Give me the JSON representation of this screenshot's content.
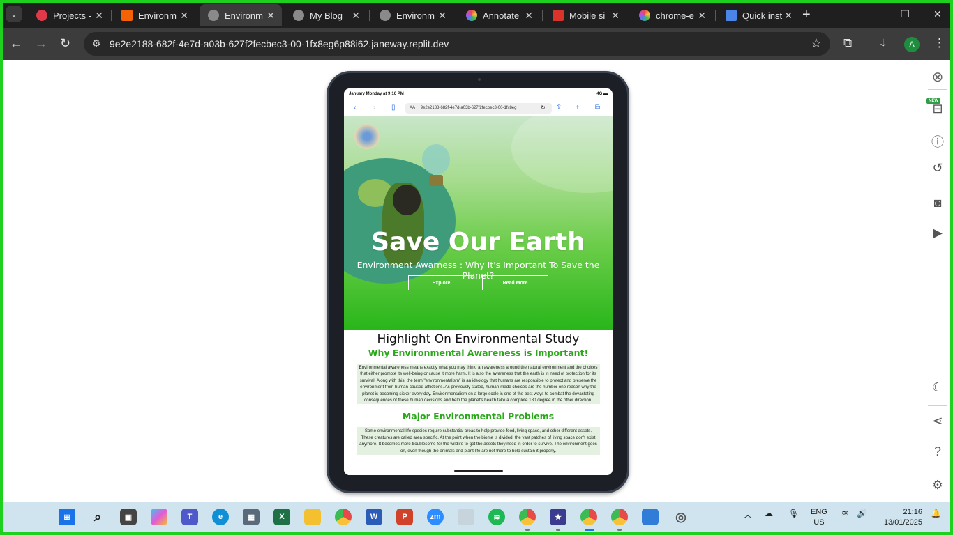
{
  "browser": {
    "tabs": [
      {
        "title": "Projects -",
        "favicon": "replit-icon",
        "color": "#e0394a"
      },
      {
        "title": "Environm",
        "favicon": "orange-icon",
        "color": "#f26207"
      },
      {
        "title": "Environm",
        "favicon": "globe-icon",
        "color": "#9a9a9a",
        "active": true
      },
      {
        "title": "My Blog",
        "favicon": "globe-icon",
        "color": "#9a9a9a"
      },
      {
        "title": "Environm",
        "favicon": "globe-icon",
        "color": "#9a9a9a"
      },
      {
        "title": "Annotate",
        "favicon": "chrome-ext-icon",
        "color": "#c04cd8"
      },
      {
        "title": "Mobile si",
        "favicon": "mobile-icon",
        "color": "#d8342c"
      },
      {
        "title": "chrome-e",
        "favicon": "chrome-ext-icon",
        "color": "#c04cd8"
      },
      {
        "title": "Quick inst",
        "favicon": "doc-icon",
        "color": "#4a86e8"
      }
    ],
    "url": "9e2e2188-682f-4e7d-a03b-627f2fecbec3-00-1fx8eg6p88i62.janeway.replit.dev",
    "profile_initial": "A"
  },
  "device": {
    "status_time": "January Monday at 9:16 PM",
    "status_signal": "4G",
    "safari_url": "9e2e2188-682f-4e7d-a03b-627f2fecbec3-00-1fx8eg",
    "safari_aa": "AA"
  },
  "hero": {
    "title": "Save Our Earth",
    "subtitle": "Environment Awarness : Why It's Important To Save the Planet?",
    "explore_label": "Explore",
    "read_more_label": "Read More"
  },
  "content": {
    "heading": "Highlight On Environmental Study",
    "subheading": "Why Environmental Awareness is Important!",
    "paragraph1": "Environmental awareness means exactly what you may think: an awareness around the natural environment and the choices that either promote its well-being or cause it more harm. It is also the awareness that the earth is in need of protection for its survival. Along with this, the term \"environmentalism\" is an ideology that humans are responsible to protect and preserve the environment from human-caused afflictions. As previously stated, human-made choices are the number one reason why the planet is becoming sicker every day. Environmentalism on a large scale is one of the best ways to combat the devastating consequences of these human decisions and help the planet's health take a complete 180 degree in the other direction.",
    "subheading2": "Major Environmental Problems",
    "paragraph2": "Some environmental life species require substantial areas to help provide food, living space, and other different assets. These creatures are called area specific. At the point when the biome is divided, the vast patches of living space don't exist anymore. It becomes more troublesome for the wildlife to get the assets they need in order to survive. The environment goes on, even though the animals and plant life are not there to help sustain it properly."
  },
  "sidepanel": {
    "new_badge": "NEW"
  },
  "taskbar": {
    "lang_top": "ENG",
    "lang_bottom": "US",
    "time": "21:16",
    "date": "13/01/2025"
  },
  "colors": {
    "chrome_bg": "#1f1f1f",
    "accent_green": "#2aa81a",
    "hero_green": "#28b61a"
  }
}
